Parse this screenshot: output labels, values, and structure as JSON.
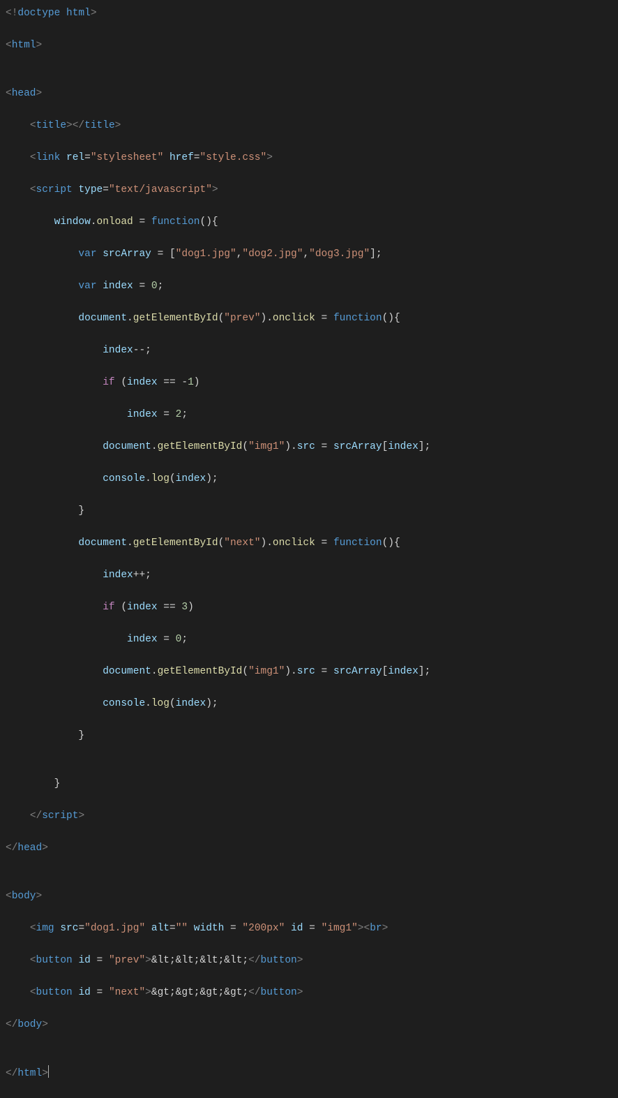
{
  "language": "html",
  "editor_theme": "dark-plus",
  "code": {
    "doctype": "doctype html",
    "html_open": "html",
    "head_open": "head",
    "title_tag": "title",
    "link": {
      "tag": "link",
      "rel_attr": "rel",
      "rel_val": "stylesheet",
      "href_attr": "href",
      "href_val": "style.css"
    },
    "script_open": {
      "tag": "script",
      "type_attr": "type",
      "type_val": "text/javascript"
    },
    "js": {
      "window": "window",
      "onload": "onload",
      "function_kw": "function",
      "var_kw": "var",
      "srcArray": "srcArray",
      "arr0": "dog1.jpg",
      "arr1": "dog2.jpg",
      "arr2": "dog3.jpg",
      "index": "index",
      "zero": "0",
      "two": "2",
      "three": "3",
      "minus1": "1",
      "document": "document",
      "getElementById": "getElementById",
      "prev_str": "prev",
      "next_str": "next",
      "img1_str": "img1",
      "onclick": "onclick",
      "if_kw": "if",
      "src_prop": "src",
      "console": "console",
      "log": "log"
    },
    "script_close": "script",
    "head_close": "head",
    "body_open": "body",
    "img": {
      "tag": "img",
      "src_attr": "src",
      "src_val": "dog1.jpg",
      "alt_attr": "alt",
      "alt_val": "",
      "width_attr": "width",
      "width_val": "200px",
      "id_attr": "id",
      "id_val": "img1"
    },
    "br": "br",
    "button1": {
      "tag": "button",
      "id_attr": "id",
      "id_val": "prev",
      "text": "&lt;&lt;&lt;&lt;"
    },
    "button2": {
      "tag": "button",
      "id_attr": "id",
      "id_val": "next",
      "text": "&gt;&gt;&gt;&gt;"
    },
    "body_close": "body",
    "html_close": "html"
  }
}
